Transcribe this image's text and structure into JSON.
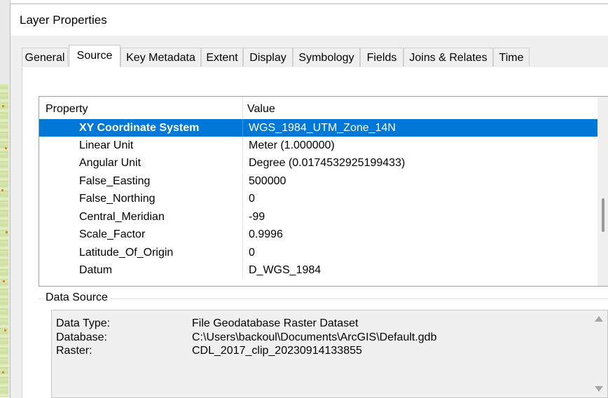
{
  "window": {
    "title": "Layer Properties"
  },
  "tabs": [
    {
      "label": "General"
    },
    {
      "label": "Source",
      "active": true
    },
    {
      "label": "Key Metadata"
    },
    {
      "label": "Extent"
    },
    {
      "label": "Display"
    },
    {
      "label": "Symbology"
    },
    {
      "label": "Fields"
    },
    {
      "label": "Joins & Relates"
    },
    {
      "label": "Time"
    }
  ],
  "grid": {
    "headers": {
      "property": "Property",
      "value": "Value"
    },
    "selected_color": "#0078d7",
    "rows": [
      {
        "property": "XY Coordinate System",
        "value": "WGS_1984_UTM_Zone_14N",
        "selected": true
      },
      {
        "property": "Linear Unit",
        "value": "Meter (1.000000)"
      },
      {
        "property": "Angular Unit",
        "value": "Degree (0.0174532925199433)"
      },
      {
        "property": "False_Easting",
        "value": "500000"
      },
      {
        "property": "False_Northing",
        "value": "0"
      },
      {
        "property": "Central_Meridian",
        "value": "-99"
      },
      {
        "property": "Scale_Factor",
        "value": "0.9996"
      },
      {
        "property": "Latitude_Of_Origin",
        "value": "0"
      },
      {
        "property": "Datum",
        "value": "D_WGS_1984"
      }
    ]
  },
  "data_source": {
    "label": "Data Source",
    "rows": [
      {
        "label": "Data Type:",
        "value": "File Geodatabase Raster Dataset"
      },
      {
        "label": "Database:",
        "value": "C:\\Users\\backoul\\Documents\\ArcGIS\\Default.gdb"
      },
      {
        "label": "Raster:",
        "value": "CDL_2017_clip_20230914133855"
      }
    ]
  }
}
